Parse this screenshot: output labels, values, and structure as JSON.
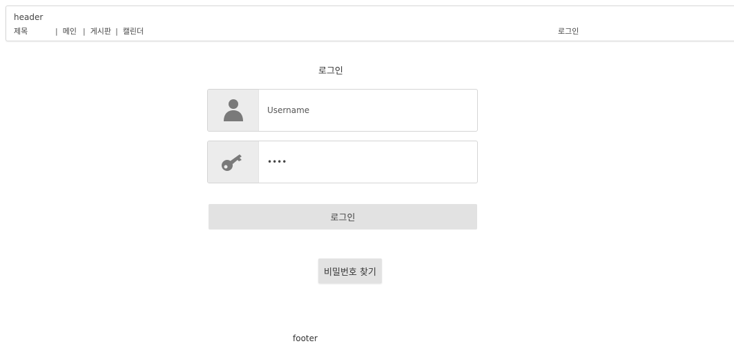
{
  "header": {
    "label": "header",
    "nav": {
      "brand": "제목",
      "items": [
        "메인",
        "게시판",
        "캘린더"
      ],
      "login": "로그인"
    }
  },
  "main": {
    "title": "로그인",
    "username": {
      "placeholder": "Username",
      "icon": "user-icon"
    },
    "password": {
      "value": "••••",
      "icon": "key-icon"
    },
    "login_button": "로그인",
    "find_password_button": "비밀번호 찾기"
  },
  "footer": {
    "label": "footer"
  },
  "colors": {
    "icon": "#7a7a7a",
    "button_bg": "#e2e2e2",
    "icon_box_bg": "#ececec"
  }
}
